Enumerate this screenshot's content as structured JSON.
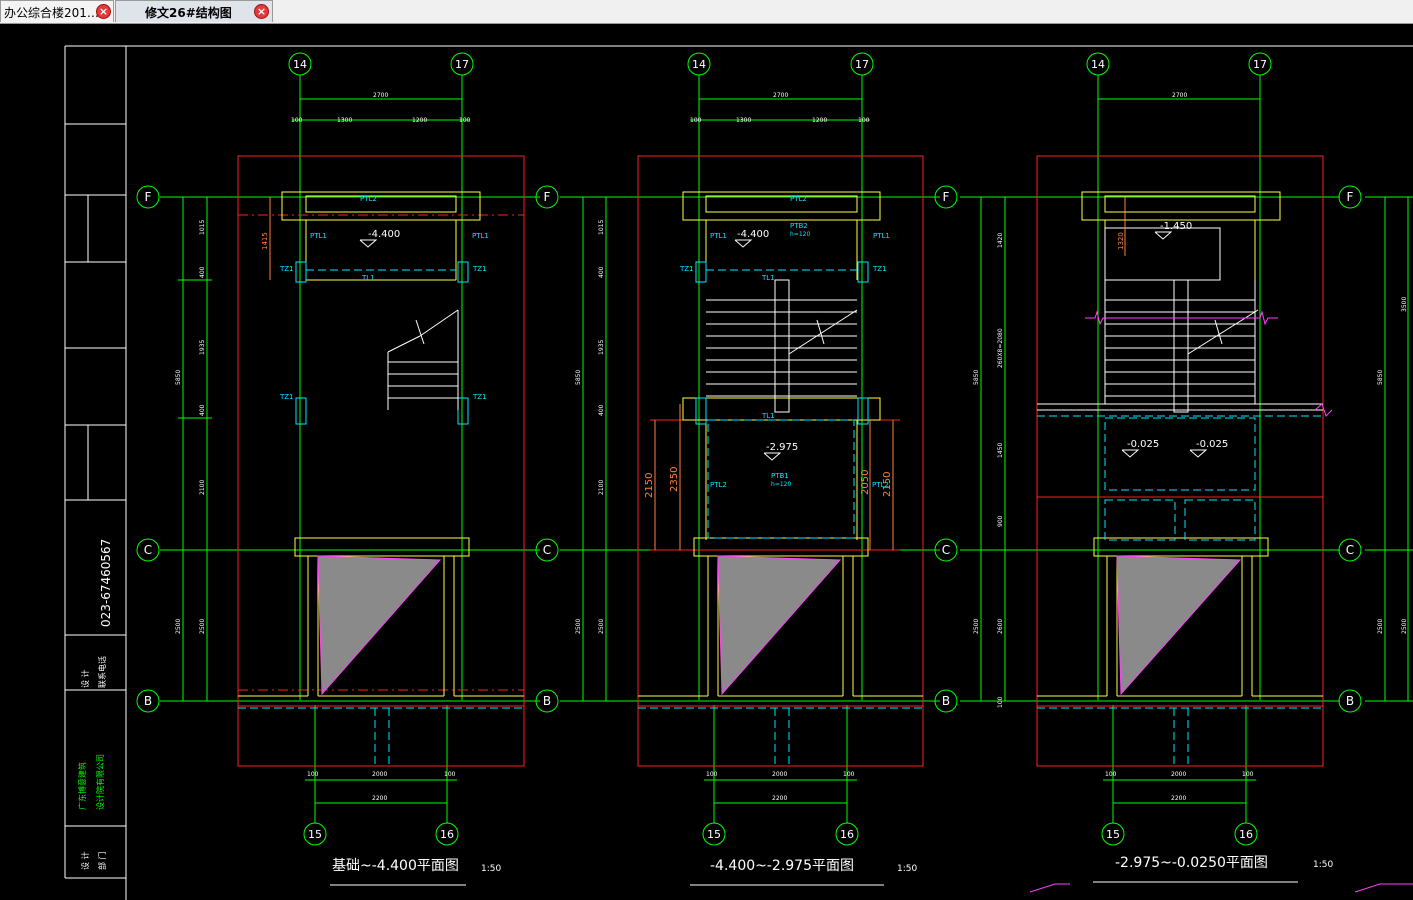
{
  "tabs": [
    {
      "label": "办公综合楼201…"
    },
    {
      "label": "修文26#结构图"
    }
  ],
  "title_block": {
    "phone": "023-67460567",
    "firm": [
      "广东博意建筑",
      "设计院有限公司"
    ],
    "rows_small": [
      "设 计",
      "联系电话"
    ],
    "dept": [
      "设 计",
      "部 门"
    ]
  },
  "axes": {
    "top_left": "14",
    "top_right": "17",
    "bottom_left": "15",
    "bottom_right": "16",
    "row_top": "F",
    "row_mid": "C",
    "row_bottom": "B"
  },
  "plans": [
    {
      "title": "基础~-4.400平面图",
      "scale": "1:50",
      "elev_main": "-4.400",
      "labels": {
        "ptl2": "PTL2",
        "ptl1": "PTL1",
        "tz1": "TZ1",
        "tl1": "TL1",
        "dim_left": "1415"
      }
    },
    {
      "title": "-4.400~-2.975平面图",
      "scale": "1:50",
      "elev_main": "-4.400",
      "elev_second": "-2.975",
      "labels": {
        "ptl2": "PTL2",
        "ptl1": "PTL1",
        "tz1": "TZ1",
        "tl1": "TL1",
        "ptb2": "PTB2",
        "ptb1": "PTB1",
        "h120": "h=120",
        "dim_a": "2150",
        "dim_b": "2350",
        "dim_c": "2050",
        "dim_d": "2150"
      }
    },
    {
      "title": "-2.975~-0.0250平面图",
      "scale": "1:50",
      "elev_main": "-1.450",
      "elev_a": "-0.025",
      "elev_b": "-0.025",
      "labels": {
        "dim_left": "1320"
      }
    }
  ],
  "dims": {
    "top_total": "2700",
    "top_a": "100",
    "top_b": "1300",
    "top_c": "1200",
    "top_d": "100",
    "bot_a": "100",
    "bot_b": "2000",
    "bot_c": "100",
    "bot_total": "2200",
    "v_total": "5850",
    "v1": "1015",
    "v2": "400",
    "v3": "1935",
    "v4": "400",
    "v5": "2100",
    "v6": "2500",
    "p3_v1": "1420",
    "p3_v2": "260X8=2080",
    "p3_v3": "1450",
    "p3_v4": "900",
    "p3_v5": "2600",
    "p3_v6": "100",
    "right_v1": "3500",
    "right_v2": "5850",
    "right_v3": "2500"
  },
  "colors": {
    "grid": "#00ff00",
    "wall": "#ff2020",
    "beam": "#ffff40",
    "cyan": "#00e5ff",
    "white": "#ffffff",
    "dim": "#ff8040"
  }
}
